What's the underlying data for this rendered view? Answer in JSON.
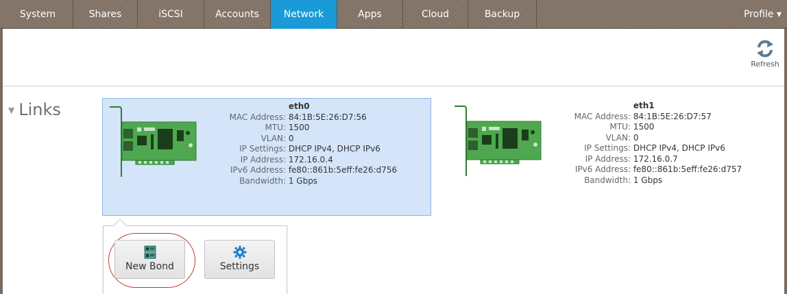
{
  "nav": {
    "tabs": [
      {
        "label": "System"
      },
      {
        "label": "Shares"
      },
      {
        "label": "iSCSI"
      },
      {
        "label": "Accounts"
      },
      {
        "label": "Network",
        "active": true
      },
      {
        "label": "Apps"
      },
      {
        "label": "Cloud"
      },
      {
        "label": "Backup"
      }
    ],
    "profile_label": "Profile ▾"
  },
  "toolbar": {
    "refresh_label": "Refresh"
  },
  "links": {
    "heading": "Links",
    "interfaces": [
      {
        "name": "eth0",
        "selected": true,
        "fields": {
          "mac_label": "MAC Address:",
          "mac": "84:1B:5E:26:D7:56",
          "mtu_label": "MTU:",
          "mtu": "1500",
          "vlan_label": "VLAN:",
          "vlan": "0",
          "ipset_label": "IP Settings:",
          "ipset": "DHCP IPv4, DHCP IPv6",
          "ip_label": "IP Address:",
          "ip": "172.16.0.4",
          "ipv6_label": "IPv6 Address:",
          "ipv6": "fe80::861b:5eff:fe26:d756",
          "bw_label": "Bandwidth:",
          "bw": "1 Gbps"
        }
      },
      {
        "name": "eth1",
        "selected": false,
        "fields": {
          "mac_label": "MAC Address:",
          "mac": "84:1B:5E:26:D7:57",
          "mtu_label": "MTU:",
          "mtu": "1500",
          "vlan_label": "VLAN:",
          "vlan": "0",
          "ipset_label": "IP Settings:",
          "ipset": "DHCP IPv4, DHCP IPv6",
          "ip_label": "IP Address:",
          "ip": "172.16.0.7",
          "ipv6_label": "IPv6 Address:",
          "ipv6": "fe80::861b:5eff:fe26:d757",
          "bw_label": "Bandwidth:",
          "bw": "1 Gbps"
        }
      }
    ]
  },
  "popover": {
    "new_bond_label": "New Bond",
    "settings_label": "Settings"
  },
  "colors": {
    "nav_bg": "#8a7b6e",
    "nav_active": "#1a9bd7",
    "selected_card": "#d4e5fa",
    "highlight": "#c0392b"
  }
}
